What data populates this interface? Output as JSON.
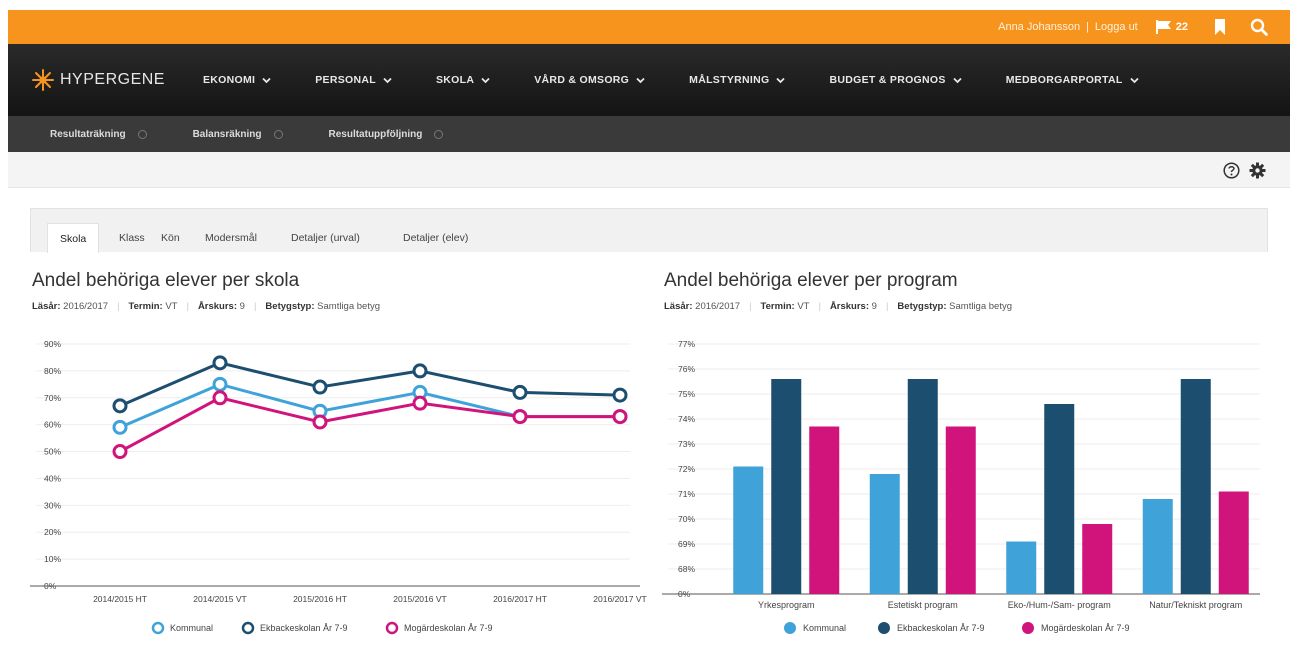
{
  "topbar": {
    "user_name": "Anna Johansson",
    "logout": "Logga ut",
    "flag_count": "22",
    "icons": [
      "flag-icon",
      "bookmark-icon",
      "search-icon"
    ]
  },
  "brand": {
    "name": "HYPERGENE"
  },
  "nav": [
    {
      "label": "EKONOMI"
    },
    {
      "label": "PERSONAL"
    },
    {
      "label": "SKOLA"
    },
    {
      "label": "VÅRD & OMSORG"
    },
    {
      "label": "MÅLSTYRNING"
    },
    {
      "label": "BUDGET & PROGNOS"
    },
    {
      "label": "MEDBORGARPORTAL"
    }
  ],
  "subnav": [
    {
      "label": "Resultaträkning"
    },
    {
      "label": "Balansräkning"
    },
    {
      "label": "Resultatuppföljning"
    }
  ],
  "tabs": [
    {
      "label": "Skola",
      "active": true
    },
    {
      "label": "Klass"
    },
    {
      "label": "Kön"
    },
    {
      "label": "Modersmål"
    },
    {
      "label": "Detaljer (urval)"
    },
    {
      "label": "Detaljer (elev)"
    }
  ],
  "filters": {
    "lasar_label": "Läsår:",
    "lasar_value": "2016/2017",
    "termin_label": "Termin:",
    "termin_value": "VT",
    "arskurs_label": "Årskurs:",
    "arskurs_value": "9",
    "betygstyp_label": "Betygstyp:",
    "betygstyp_value": "Samtliga betyg"
  },
  "colors": {
    "kommunal": "#3fa3d9",
    "ekbacke": "#1c4e6f",
    "mogarde": "#d1147b",
    "orange": "#f7941d"
  },
  "chart_data": [
    {
      "type": "line",
      "title": "Andel behöriga elever per skola",
      "x": [
        "2014/2015 HT",
        "2014/2015 VT",
        "2015/2016 HT",
        "2015/2016 VT",
        "2016/2017 HT",
        "2016/2017 VT"
      ],
      "yticks": [
        "0%",
        "10%",
        "20%",
        "30%",
        "40%",
        "50%",
        "60%",
        "70%",
        "80%",
        "90%"
      ],
      "ylim": [
        0,
        90
      ],
      "series": [
        {
          "name": "Kommunal",
          "values": [
            59,
            75,
            65,
            72,
            63,
            63
          ]
        },
        {
          "name": "Ekbackeskolan År 7-9",
          "values": [
            67,
            83,
            74,
            80,
            72,
            71
          ]
        },
        {
          "name": "Mogärdeskolan År 7-9",
          "values": [
            50,
            70,
            61,
            68,
            63,
            63
          ]
        }
      ],
      "legend": "bottom"
    },
    {
      "type": "bar",
      "title": "Andel behöriga elever per program",
      "categories": [
        "Yrkesprogram",
        "Estetiskt program",
        "Eko-/Hum-/Sam- program",
        "Natur/Tekniskt program"
      ],
      "yticks": [
        "0%",
        "68%",
        "69%",
        "70%",
        "71%",
        "72%",
        "73%",
        "74%",
        "75%",
        "76%",
        "77%"
      ],
      "ylim": [
        67,
        77
      ],
      "series": [
        {
          "name": "Kommunal",
          "values": [
            72.1,
            71.8,
            69.1,
            70.8
          ]
        },
        {
          "name": "Ekbackeskolan År 7-9",
          "values": [
            75.6,
            75.6,
            74.6,
            75.6
          ]
        },
        {
          "name": "Mogärdeskolan År 7-9",
          "values": [
            73.7,
            73.7,
            69.8,
            71.1
          ]
        }
      ],
      "legend": "bottom"
    }
  ]
}
